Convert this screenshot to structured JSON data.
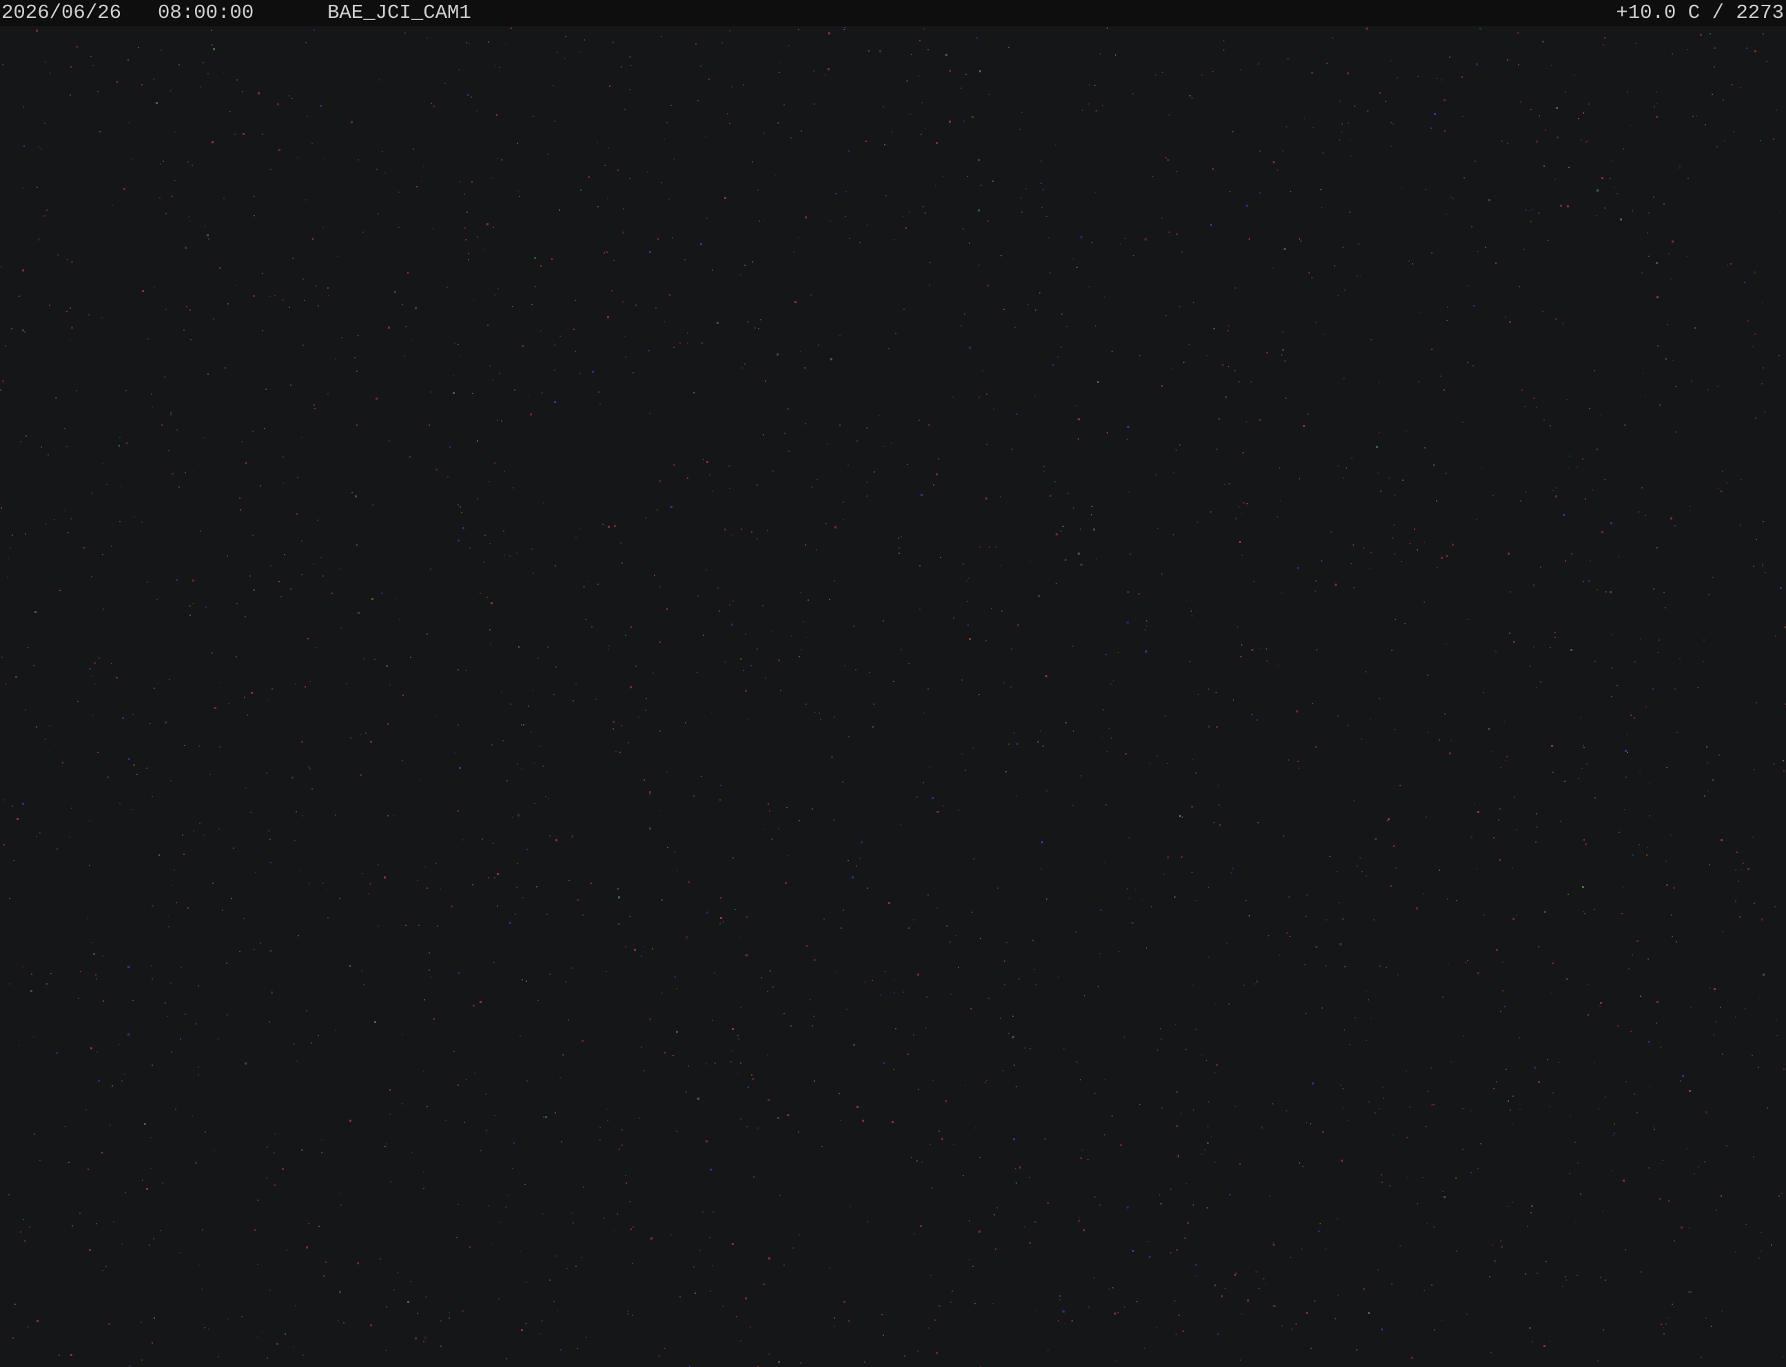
{
  "overlay": {
    "date": "2026/06/26",
    "time": "08:00:00",
    "camera_id": "BAE_JCI_CAM1",
    "sensor_readout": "+10.0 C / 2273"
  },
  "frame": {
    "content": "dark-sky-noise",
    "colors": {
      "background": "#151617",
      "overlay_bar": "#0e0e0f",
      "overlay_text": "#cfcfcf",
      "noise_red": "#c0303a",
      "noise_green": "#3a8a3a",
      "noise_blue": "#3a3acf"
    }
  }
}
